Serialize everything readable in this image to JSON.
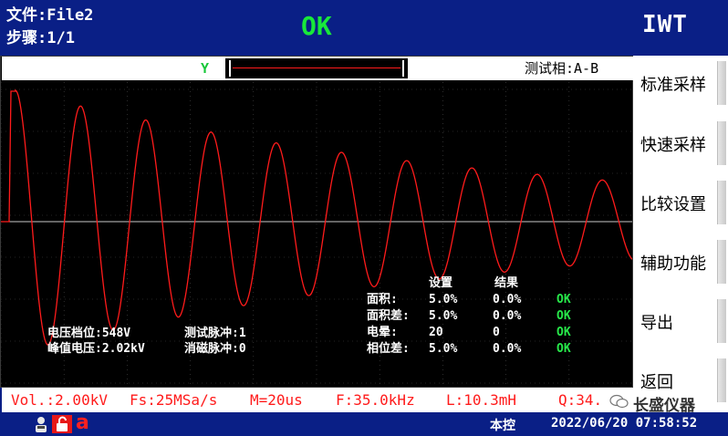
{
  "header": {
    "file_label": "文件:File2",
    "step_label": "步骤:1/1",
    "status": "OK",
    "brand": "IWT"
  },
  "scope": {
    "channel": "Y",
    "test_phase": "测试相:A-B"
  },
  "menu": {
    "items": [
      {
        "label": "标准采样"
      },
      {
        "label": "快速采样"
      },
      {
        "label": "比较设置"
      },
      {
        "label": "辅助功能"
      },
      {
        "label": "导出"
      },
      {
        "label": "返回"
      }
    ]
  },
  "info": {
    "voltage_gear": "电压档位:548V",
    "peak_voltage": "峰值电压:2.02kV",
    "test_pulse": "测试脉冲:1",
    "demag_pulse": "消磁脉冲:0"
  },
  "results": {
    "header_setting": "设置",
    "header_result": "结果",
    "rows": [
      {
        "name": "面积:",
        "setting": "5.0%",
        "result": "0.0%",
        "status": "OK"
      },
      {
        "name": "面积差:",
        "setting": "5.0%",
        "result": "0.0%",
        "status": "OK"
      },
      {
        "name": "电晕:",
        "setting": "20",
        "result": "0",
        "status": "OK"
      },
      {
        "name": "相位差:",
        "setting": "5.0%",
        "result": "0.0%",
        "status": "OK"
      }
    ]
  },
  "statusline": {
    "vol": "Vol.:2.00kV",
    "fs": "Fs:25MSa/s",
    "m": "M=20us",
    "f": "F:35.0kHz",
    "l": "L:10.3mH",
    "q": "Q:34.",
    "watermark": "长盛仪器"
  },
  "bottom": {
    "mode": "本控",
    "datetime": "2022/06/20 07:58:52",
    "letter": "a"
  },
  "colors": {
    "background_blue": "#0a1f86",
    "ok_green": "#18e83a",
    "wave_red": "#ff1b1b"
  }
}
